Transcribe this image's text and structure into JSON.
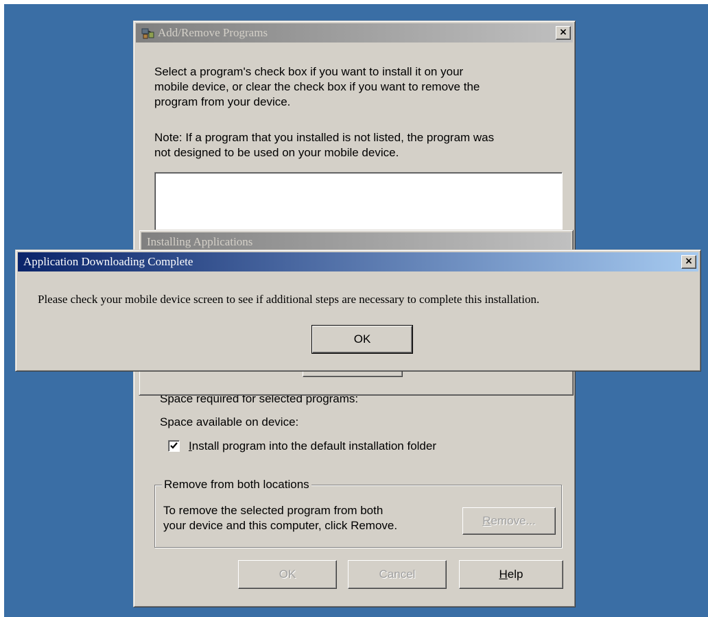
{
  "main_dialog": {
    "title": "Add/Remove Programs",
    "close_label": "×",
    "instructions": [
      "Select a program's check box if you want to install it on your",
      "mobile device, or clear the check box if you want to remove the",
      "program from your device."
    ],
    "note": [
      "Note:  If a program that you installed is not listed, the program was",
      "not designed to be used on your mobile device."
    ],
    "space_required_label": "Space required for selected programs:",
    "space_available_label": "Space available on device:",
    "install_default_checkbox": {
      "label_first": "I",
      "label_rest": "nstall program into the default installation folder",
      "checked": true
    },
    "remove_group": {
      "title": "Remove from both locations",
      "description": [
        "To remove the selected program from both",
        "your device and this computer, click Remove."
      ],
      "remove_button_first": "R",
      "remove_button_rest": "emove..."
    },
    "buttons": {
      "ok": "OK",
      "cancel": "Cancel",
      "help_first": "H",
      "help_rest": "elp"
    }
  },
  "installing_dialog": {
    "title": "Installing Applications"
  },
  "complete_dialog": {
    "title": "Application Downloading Complete",
    "close_label": "×",
    "message": "Please check your mobile device screen to see if additional steps are necessary to complete this installation.",
    "ok_label": "OK"
  },
  "colors": {
    "desktop": "#3a6ea5",
    "active_title_start": "#0a246a",
    "active_title_end": "#a6caf0",
    "inactive_title": "#808080",
    "face": "#d4d0c8"
  }
}
